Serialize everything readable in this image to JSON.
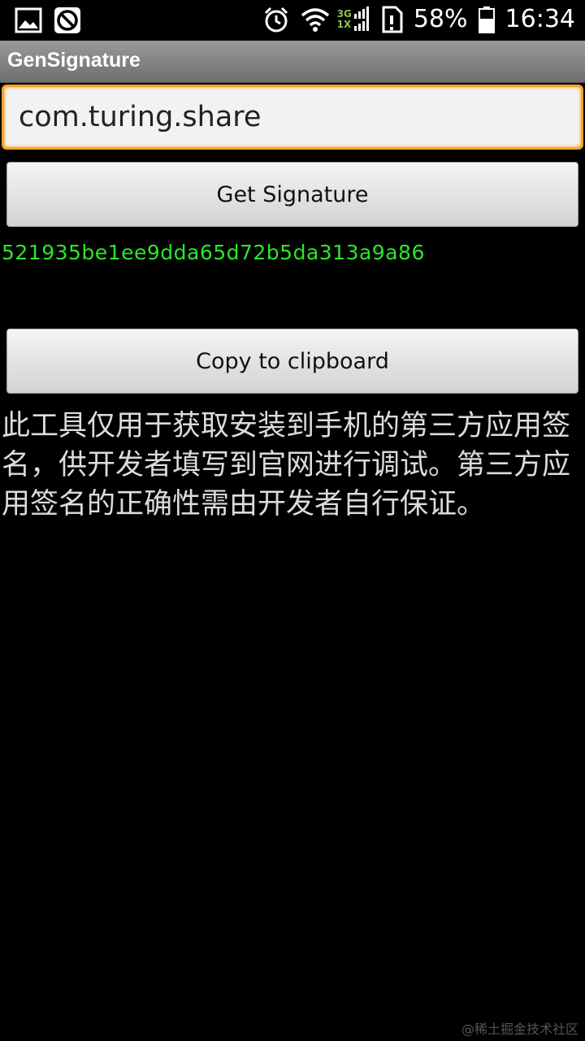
{
  "status_bar": {
    "icons_left": [
      "image-icon",
      "blocked-icon"
    ],
    "icons_right": [
      "alarm-icon",
      "wifi-icon",
      "signal-icon",
      "sim-icon"
    ],
    "network_top": "3G",
    "network_bottom": "1X",
    "battery": "58%",
    "time": "16:34"
  },
  "app": {
    "title": "GenSignature"
  },
  "form": {
    "package_value": "com.turing.share",
    "get_signature_label": "Get Signature",
    "signature_value": "521935be1ee9dda65d72b5da313a9a86",
    "copy_label": "Copy to clipboard",
    "description": "此工具仅用于获取安装到手机的第三方应用签名，供开发者填写到官网进行调试。第三方应用签名的正确性需由开发者自行保证。"
  },
  "watermark": "@稀土掘金技术社区",
  "colors": {
    "accent": "#f7a12a",
    "signature_text": "#2ee52a"
  }
}
